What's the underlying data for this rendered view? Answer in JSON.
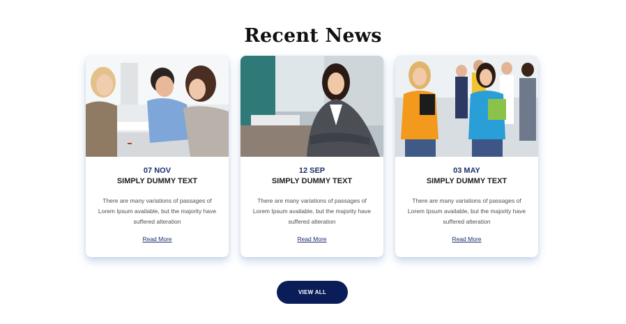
{
  "section": {
    "title": "Recent News"
  },
  "cards": [
    {
      "date": "07 NOV",
      "title": "SIMPLY DUMMY TEXT",
      "text": "There are many variations of passages of Lorem Ipsum available, but the majority have suffered alteration",
      "link": "Read More",
      "image": "office-meeting-photo"
    },
    {
      "date": "12 SEP",
      "title": "SIMPLY DUMMY TEXT",
      "text": "There are many variations of passages of Lorem Ipsum available, but the majority have suffered alteration",
      "link": "Read More",
      "image": "business-woman-photo"
    },
    {
      "date": "03 MAY",
      "title": "SIMPLY DUMMY TEXT",
      "text": "There are many variations of passages of Lorem Ipsum available, but the majority have suffered alteration",
      "link": "Read More",
      "image": "students-group-photo"
    }
  ],
  "actions": {
    "view_all": "VIEW ALL"
  },
  "colors": {
    "accent": "#0b1d58",
    "date_text": "#1b2d6b",
    "card_shadow": "#4a78bc"
  }
}
